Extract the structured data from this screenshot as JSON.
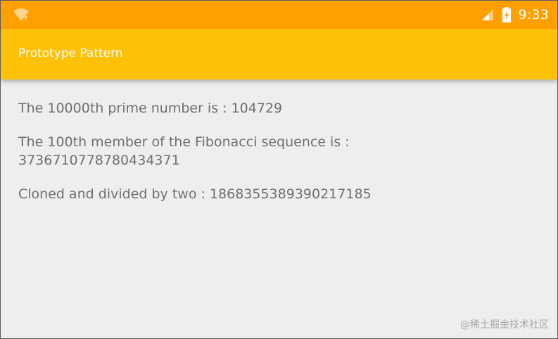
{
  "status_bar": {
    "time": "9:33",
    "icons": [
      "wifi-question-icon",
      "cellular-signal-icon",
      "battery-charging-icon"
    ]
  },
  "app_bar": {
    "title": "Prototype Pattern"
  },
  "content": {
    "lines": [
      "The 10000th prime number is : 104729",
      "The 100th member of the Fibonacci sequence is :",
      "3736710778780434371",
      "Cloned and divided by two : 1868355389390217185"
    ]
  },
  "watermark": {
    "text": "@稀土掘金技术社区"
  },
  "colors": {
    "status_bar": "#ffa000",
    "app_bar": "#ffc107",
    "background": "#eeeeee",
    "text": "#6f6f6f",
    "frame_border": "#5a5a5a"
  }
}
